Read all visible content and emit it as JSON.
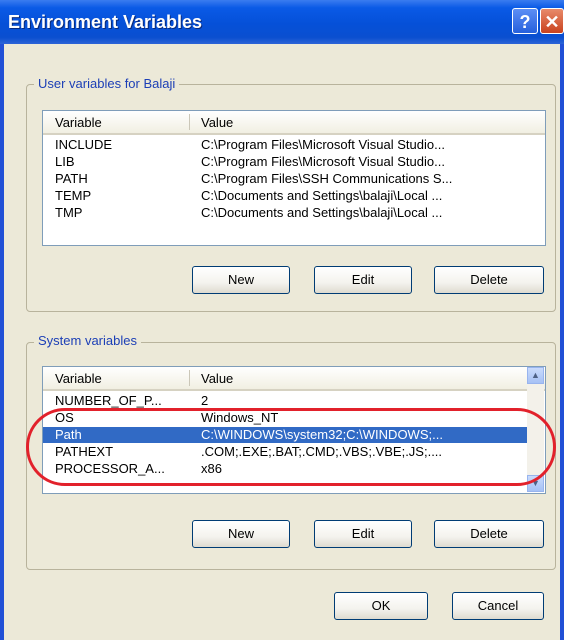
{
  "window": {
    "title": "Environment Variables",
    "help_glyph": "?",
    "close_glyph": "✕"
  },
  "user_vars": {
    "legend": "User variables for Balaji",
    "headers": {
      "variable": "Variable",
      "value": "Value"
    },
    "rows": [
      {
        "variable": "INCLUDE",
        "value": "C:\\Program Files\\Microsoft Visual Studio..."
      },
      {
        "variable": "LIB",
        "value": "C:\\Program Files\\Microsoft Visual Studio..."
      },
      {
        "variable": "PATH",
        "value": "C:\\Program Files\\SSH Communications S..."
      },
      {
        "variable": "TEMP",
        "value": "C:\\Documents and Settings\\balaji\\Local ..."
      },
      {
        "variable": "TMP",
        "value": "C:\\Documents and Settings\\balaji\\Local ..."
      }
    ],
    "buttons": {
      "new": "New",
      "edit": "Edit",
      "delete": "Delete"
    }
  },
  "system_vars": {
    "legend": "System variables",
    "headers": {
      "variable": "Variable",
      "value": "Value"
    },
    "rows": [
      {
        "variable": "NUMBER_OF_P...",
        "value": "2"
      },
      {
        "variable": "OS",
        "value": "Windows_NT"
      },
      {
        "variable": "Path",
        "value": "C:\\WINDOWS\\system32;C:\\WINDOWS;...",
        "selected": true
      },
      {
        "variable": "PATHEXT",
        "value": ".COM;.EXE;.BAT;.CMD;.VBS;.VBE;.JS;...."
      },
      {
        "variable": "PROCESSOR_A...",
        "value": "x86"
      }
    ],
    "buttons": {
      "new": "New",
      "edit": "Edit",
      "delete": "Delete"
    },
    "scroll_up_glyph": "▲",
    "scroll_down_glyph": "▼"
  },
  "footer": {
    "ok": "OK",
    "cancel": "Cancel"
  },
  "colors": {
    "title_bar": "#0550d8",
    "selection": "#316ac5",
    "highlight_ring": "#e2212b",
    "dialog_bg": "#ece9d8"
  }
}
